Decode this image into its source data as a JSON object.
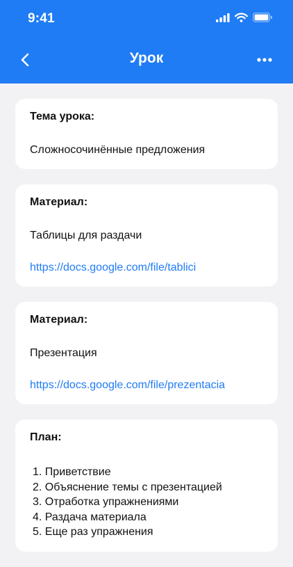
{
  "status_bar": {
    "time": "9:41"
  },
  "nav": {
    "title": "Урок"
  },
  "topic": {
    "label": "Тема урока:",
    "value": "Сложносочинённые предложения"
  },
  "materials": [
    {
      "label": "Материал:",
      "name": "Таблицы для раздачи",
      "link": "https://docs.google.com/file/tablici"
    },
    {
      "label": "Материал:",
      "name": "Презентация",
      "link": "https://docs.google.com/file/prezentacia"
    }
  ],
  "plan": {
    "label": "План:",
    "items": [
      "1. Приветствие",
      "2. Объяснение темы с презентацией",
      "3. Отработка упражнениями",
      "4. Раздача материала",
      "5. Еще раз упражнения"
    ]
  },
  "colors": {
    "accent": "#1f7cf5",
    "background": "#f2f2f5",
    "card": "#ffffff"
  }
}
